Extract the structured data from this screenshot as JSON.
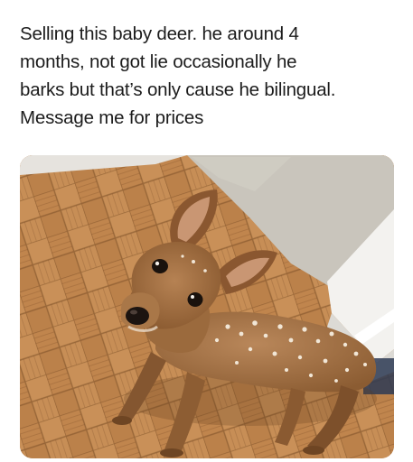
{
  "meme": {
    "caption_lines": [
      "Selling this baby deer. he around 4",
      "months, not got lie occasionally he",
      "barks but that’s only cause he bilingual.",
      "Message me for prices"
    ]
  },
  "photo": {
    "subject": "brown dog with white spots resembling a fawn",
    "colors": {
      "floor_light": "#c48a52",
      "floor_dark": "#9a6535",
      "carpet": "#c9c5bc",
      "wall": "#e6e3de",
      "fur": "#9b6a3d",
      "fur_light": "#b9875a",
      "spots": "#f1e6d6"
    }
  }
}
